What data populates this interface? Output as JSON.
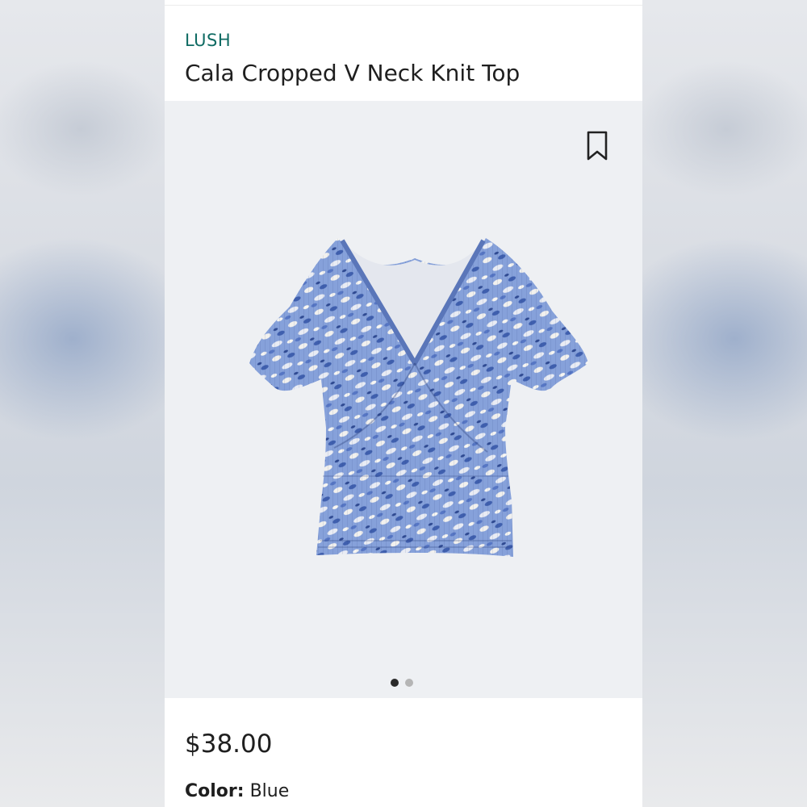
{
  "product": {
    "brand": "LUSH",
    "title": "Cala Cropped V Neck Knit Top",
    "price": "$38.00",
    "color_label": "Color:",
    "color_value": "Blue"
  },
  "gallery": {
    "image_count": 2,
    "active_index": 0
  },
  "icons": {
    "save": "bookmark-icon"
  },
  "colors": {
    "brand": "#0f6b63",
    "text": "#1f1f1f",
    "image_bg": "#eef0f3",
    "garment": "#7d9ad6"
  }
}
